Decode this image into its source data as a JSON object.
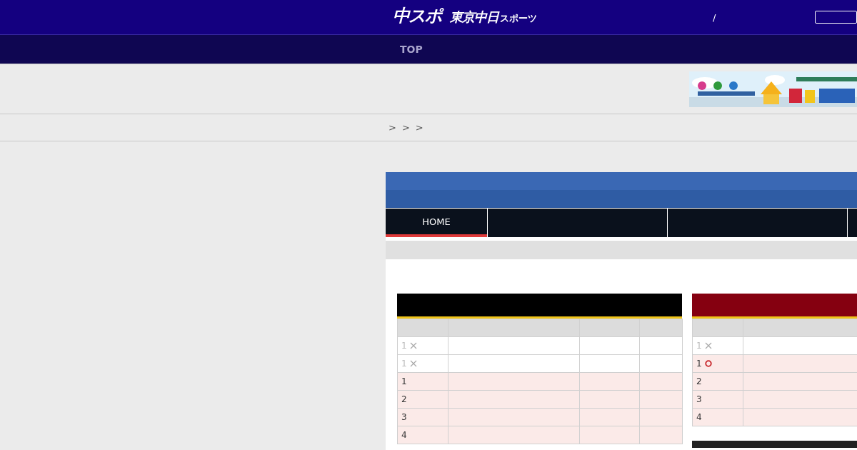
{
  "header": {
    "logo": {
      "main": "中スポ",
      "sub": "東京中日",
      "suffix": "スポーツ"
    },
    "separator": "/"
  },
  "nav": {
    "items": [
      {
        "label": "TOP"
      }
    ]
  },
  "breadcrumb": {
    "separators": [
      ">",
      ">",
      ">"
    ]
  },
  "tabs": [
    {
      "label": "HOME",
      "selected": true
    },
    {
      "selected": false
    },
    {
      "selected": false
    },
    {
      "selected": false
    }
  ],
  "tables": [
    {
      "color": "#000000",
      "rows": [
        {
          "rank": "1",
          "kind": "lose",
          "highlighted": false
        },
        {
          "rank": "1",
          "kind": "lose",
          "highlighted": false
        },
        {
          "rank": "1",
          "highlighted": true
        },
        {
          "rank": "2",
          "highlighted": true
        },
        {
          "rank": "3",
          "highlighted": true
        },
        {
          "rank": "4",
          "highlighted": true
        }
      ]
    },
    {
      "color": "#850010",
      "rows": [
        {
          "rank": "1",
          "kind": "lose",
          "highlighted": false
        },
        {
          "rank": "1",
          "kind": "win",
          "highlighted": true
        },
        {
          "rank": "2",
          "highlighted": true
        },
        {
          "rank": "3",
          "highlighted": true
        },
        {
          "rank": "4",
          "highlighted": true
        }
      ]
    }
  ]
}
